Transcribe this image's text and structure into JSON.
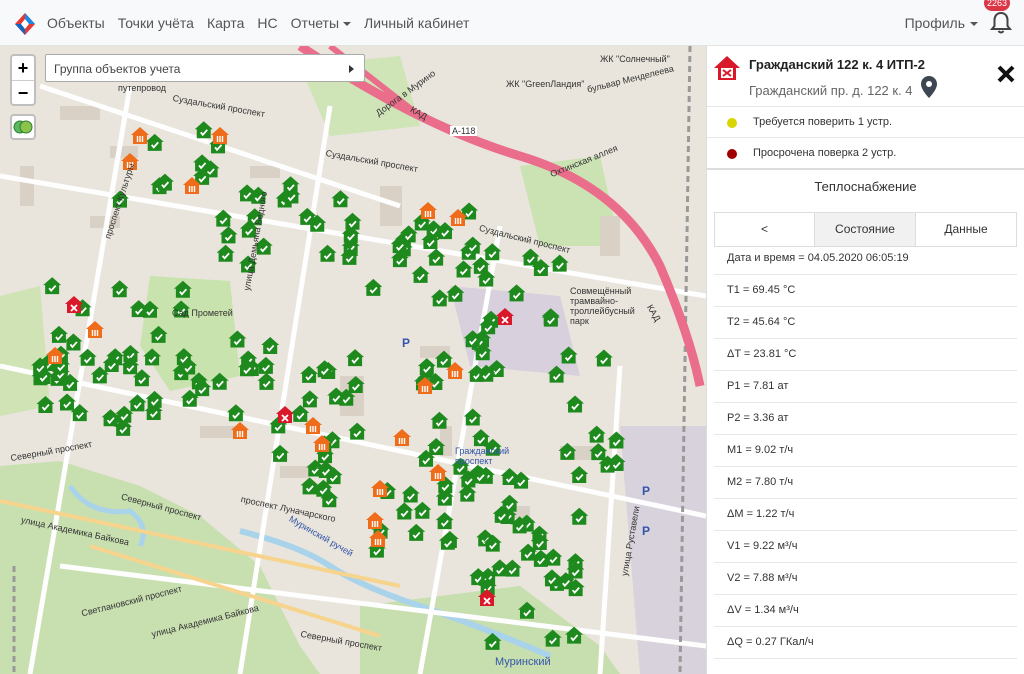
{
  "navbar": {
    "items": [
      {
        "label": "Объекты"
      },
      {
        "label": "Точки учёта"
      },
      {
        "label": "Карта"
      },
      {
        "label": "НС"
      },
      {
        "label": "Отчеты",
        "dropdown": true
      },
      {
        "label": "Личный кабинет"
      }
    ],
    "profile_label": "Профиль",
    "notification_count": "2263"
  },
  "map": {
    "zoom_in": "+",
    "zoom_out": "−",
    "group_placeholder": "Группа объектов учета",
    "labels": [
      "путепровод",
      "Суздальский проспект",
      "Суздальский проспект",
      "Суздальский проспект",
      "Дорога в Мурино",
      "КАД",
      "КАД",
      "А-118",
      "бульвар Менделеева",
      "ЖК \"Солнечный\"",
      "ЖК \"GreenЛандия\"",
      "Охтинская аллея",
      "Сад Прометей",
      "Гражданский проспект",
      "Совмещённый трамвайно-троллейбусный парк",
      "улица Демьяна Бедного",
      "проспект Культуры",
      "улица Руставели",
      "Северный проспект",
      "Северный проспект",
      "Северный проспект",
      "проспект Луначарского",
      "улица Академика Байкова",
      "улица Академика Байкова",
      "Светлановский проспект",
      "Муринский ручей",
      "Муринский",
      "P",
      "P",
      "P"
    ],
    "colors": {
      "ok": "#1e8a1e",
      "warning": "#ef6c1a",
      "error": "#d9182a",
      "road": "#ea6d8b"
    }
  },
  "panel": {
    "title": "Гражданский 122 к. 4 ИТП-2",
    "address": "Гражданский пр. д. 122 к. 4",
    "statuses": [
      {
        "text": "Требуется поверить 1 устр.",
        "color": "#d9d500"
      },
      {
        "text": "Просрочена поверка 2 устр.",
        "color": "#a00000"
      }
    ],
    "section": "Теплоснабжение",
    "tabs": {
      "back": "<",
      "state": "Состояние",
      "data": "Данные"
    },
    "rows": [
      "Дата и время = 04.05.2020 06:05:19",
      "T1 = 69.45 °C",
      "T2 = 45.64 °C",
      "ΔT = 23.81 °C",
      "P1 = 7.81 ат",
      "P2 = 3.36 ат",
      "M1 = 9.02 т/ч",
      "M2 = 7.80 т/ч",
      "ΔM = 1.22 т/ч",
      "V1 = 9.22 м³/ч",
      "V2 = 7.88 м³/ч",
      "ΔV = 1.34 м³/ч",
      "ΔQ = 0.27 ГКал/ч"
    ]
  }
}
